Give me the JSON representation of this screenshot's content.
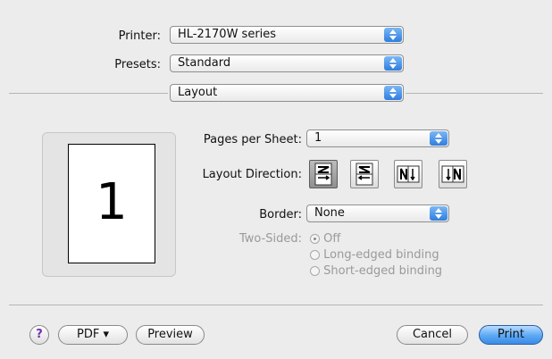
{
  "printer": {
    "label": "Printer:",
    "value": "HL-2170W series"
  },
  "presets": {
    "label": "Presets:",
    "value": "Standard"
  },
  "panel": {
    "value": "Layout"
  },
  "preview": {
    "page_number": "1"
  },
  "layout": {
    "pages_per_sheet": {
      "label": "Pages per Sheet:",
      "value": "1"
    },
    "direction": {
      "label": "Layout Direction:",
      "buttons": [
        {
          "icon": "z-direction-icon",
          "selected": true
        },
        {
          "icon": "s-direction-icon",
          "selected": false
        },
        {
          "icon": "reverse-n-direction-icon",
          "selected": false
        },
        {
          "icon": "n-direction-icon",
          "selected": false
        }
      ]
    },
    "border": {
      "label": "Border:",
      "value": "None"
    },
    "two_sided": {
      "label": "Two-Sided:",
      "options": [
        "Off",
        "Long-edged binding",
        "Short-edged binding"
      ],
      "selected": "Off"
    }
  },
  "buttons": {
    "help": "?",
    "pdf": "PDF ▾",
    "preview": "Preview",
    "cancel": "Cancel",
    "print": "Print"
  },
  "colors": {
    "accent": "#3c8ae6",
    "window_bg": "#ececec"
  }
}
